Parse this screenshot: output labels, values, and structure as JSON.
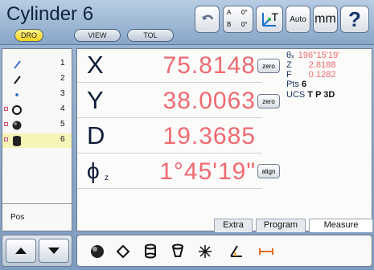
{
  "header": {
    "title": "Cylinder 6",
    "mode_buttons": [
      "DRO",
      "VIEW",
      "TOL"
    ],
    "tool_buttons": {
      "auto": "Auto",
      "units": "mm",
      "help": "?",
      "coord_a": "A",
      "coord_b": "B",
      "coord_zero1": "0°",
      "coord_zero2": "0°",
      "teach": "T"
    }
  },
  "feature_list": [
    {
      "number": "1",
      "type": "line-icon",
      "marked": false,
      "selected": false
    },
    {
      "number": "2",
      "type": "line-icon",
      "marked": false,
      "selected": false
    },
    {
      "number": "3",
      "type": "point-icon",
      "marked": false,
      "selected": false
    },
    {
      "number": "4",
      "type": "circle-icon",
      "marked": true,
      "selected": false
    },
    {
      "number": "5",
      "type": "sphere-icon",
      "marked": true,
      "selected": false
    },
    {
      "number": "6",
      "type": "cylinder-icon",
      "marked": true,
      "selected": true
    }
  ],
  "left_tab": "Pos",
  "dro": {
    "x": {
      "label": "X",
      "value": "75.8148",
      "button": "zero"
    },
    "y": {
      "label": "Y",
      "value": "38.0063",
      "button": "zero"
    },
    "d": {
      "label": "D",
      "value": "19.3685"
    },
    "phi": {
      "label": "ϕ",
      "sub": "z",
      "value": "1°45'19\"",
      "button": "align"
    }
  },
  "info": {
    "theta_label": "θₓ",
    "theta_value": "196°15'19'",
    "z_label": "Z",
    "z_value": "2.8188",
    "f_label": "F",
    "f_value": "0.1282",
    "pts_label": "Pts",
    "pts_value": "6",
    "ucs_label": "UCS",
    "ucs_value": "T P 3D"
  },
  "tabs": [
    "Extra",
    "Program",
    "Measure"
  ],
  "bottom_tools": [
    "sphere-icon",
    "plane-icon",
    "cylinder-icon",
    "cone-icon",
    "point-cloud-icon",
    "angle-icon",
    "distance-icon"
  ]
}
